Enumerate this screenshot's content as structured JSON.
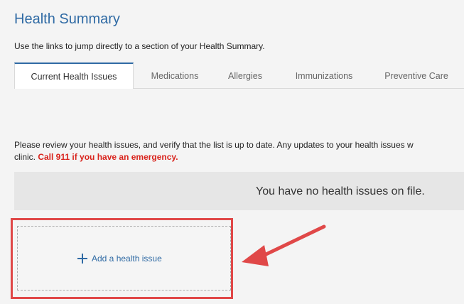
{
  "page": {
    "title": "Health Summary",
    "subtitle": "Use the links to jump directly to a section of your Health Summary."
  },
  "tabs": [
    {
      "label": "Current Health Issues",
      "active": true
    },
    {
      "label": "Medications",
      "active": false
    },
    {
      "label": "Allergies",
      "active": false
    },
    {
      "label": "Immunizations",
      "active": false
    },
    {
      "label": "Preventive Care",
      "active": false
    }
  ],
  "notice": {
    "line1": "Please review your health issues, and verify that the list is up to date. Any updates to your health issues w",
    "line2_prefix": "clinic. ",
    "emergency": "Call 911 if you have an emergency."
  },
  "empty_state": {
    "message": "You have no health issues on file."
  },
  "add_issue": {
    "label": "Add a health issue",
    "icon": "plus-icon"
  },
  "colors": {
    "accent": "#2f6aa4",
    "emergency": "#d9231c",
    "highlight": "#e04848"
  }
}
